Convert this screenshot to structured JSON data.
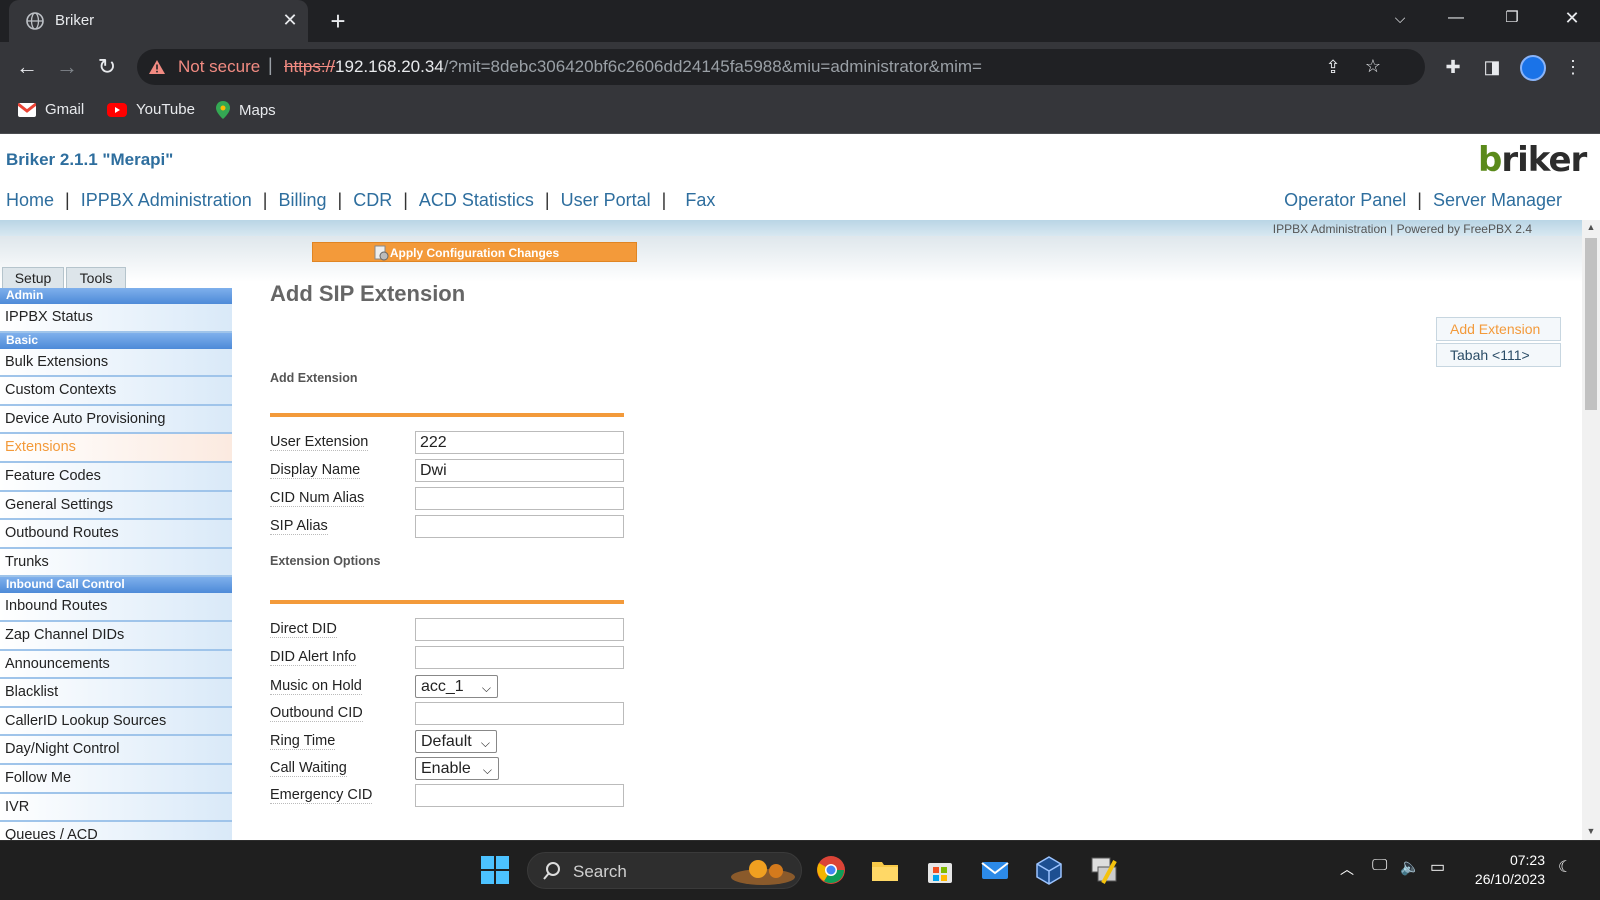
{
  "browser": {
    "tab_title": "Briker",
    "tab_close": "✕",
    "new_tab": "+",
    "security_label": "Not secure",
    "url_scheme": "https://",
    "url_host": "192.168.20.34",
    "url_path": "/?mit=8debc306420bf6c2606dd24145fa5988&miu=administrator&mim=",
    "bookmarks": [
      "Gmail",
      "YouTube",
      "Maps"
    ]
  },
  "app": {
    "title": "Briker 2.1.1 \"Merapi\"",
    "logo_first": "b",
    "logo_rest": "riker",
    "nav_left": [
      "Home",
      "IPPBX Administration",
      "Billing",
      "CDR",
      "ACD Statistics",
      "User Portal",
      "Fax"
    ],
    "nav_right": [
      "Operator Panel",
      "Server Manager"
    ],
    "nav_sep": "|",
    "powered_by": "IPPBX Administration | Powered by FreePBX 2.4",
    "apply_button": "Apply Configuration Changes"
  },
  "sidebar": {
    "tabs": [
      "Setup",
      "Tools"
    ],
    "admin_header": "Admin",
    "admin_items": [
      "IPPBX Status"
    ],
    "basic_header": "Basic",
    "basic_items": [
      "Bulk Extensions",
      "Custom Contexts",
      "Device Auto Provisioning",
      "Extensions",
      "Feature Codes",
      "General Settings",
      "Outbound Routes",
      "Trunks"
    ],
    "inbound_header": "Inbound Call Control",
    "inbound_items": [
      "Inbound Routes",
      "Zap Channel DIDs",
      "Announcements",
      "Blacklist",
      "CallerID Lookup Sources",
      "Day/Night Control",
      "Follow Me",
      "IVR",
      "Queues / ACD"
    ],
    "selected": "Extensions"
  },
  "main": {
    "title": "Add SIP Extension",
    "ext_list": {
      "add": "Add Extension",
      "items": [
        "Tabah <111>"
      ]
    },
    "section1": "Add Extension",
    "user_extension_label": "User Extension",
    "user_extension_value": "222",
    "display_name_label": "Display Name",
    "display_name_value": "Dwi",
    "cid_num_alias_label": "CID Num Alias",
    "cid_num_alias_value": "",
    "sip_alias_label": "SIP Alias",
    "sip_alias_value": "",
    "section2": "Extension Options",
    "direct_did_label": "Direct DID",
    "direct_did_value": "",
    "did_alert_label": "DID Alert Info",
    "did_alert_value": "",
    "moh_label": "Music on Hold",
    "moh_value": "acc_1",
    "outbound_cid_label": "Outbound CID",
    "outbound_cid_value": "",
    "ring_time_label": "Ring Time",
    "ring_time_value": "Default",
    "call_waiting_label": "Call Waiting",
    "call_waiting_value": "Enable",
    "emergency_cid_label": "Emergency CID",
    "emergency_cid_value": ""
  },
  "taskbar": {
    "search_label": "Search",
    "time": "07:23",
    "date": "26/10/2023"
  },
  "colors": {
    "accent_orange": "#f39a3a",
    "link_blue": "#2e6e9e",
    "sidebar_header": "#4d8ad8"
  }
}
